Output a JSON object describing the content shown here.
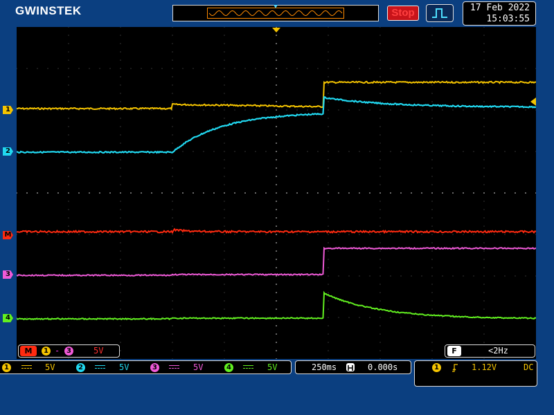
{
  "brand": "GWINSTEK",
  "run_state": "Stop",
  "datetime": {
    "date": "17 Feb 2022",
    "time": "15:03:55"
  },
  "colors": {
    "ch1": "#f5c400",
    "ch2": "#21d8f0",
    "ch3": "#f05ad8",
    "ch4": "#62f020",
    "math": "#ff2a10",
    "stop": "#ff4040",
    "grid": "#6a6a6a"
  },
  "channel_markers": [
    {
      "id": "1",
      "label": "1"
    },
    {
      "id": "2",
      "label": "2"
    },
    {
      "id": "M",
      "label": "M"
    },
    {
      "id": "3",
      "label": "3"
    },
    {
      "id": "4",
      "label": "4"
    }
  ],
  "math": {
    "badge": "M",
    "src_a": "1",
    "op": "-",
    "src_b": "3",
    "scale": "5V"
  },
  "frequency": {
    "badge": "F",
    "value": "<2Hz"
  },
  "channels": [
    {
      "num": "1",
      "coupling_icon": "dc-coupling-icon",
      "scale": "5V"
    },
    {
      "num": "2",
      "coupling_icon": "dc-coupling-icon",
      "scale": "5V"
    },
    {
      "num": "3",
      "coupling_icon": "dc-coupling-icon",
      "scale": "5V"
    },
    {
      "num": "4",
      "coupling_icon": "dc-coupling-icon",
      "scale": "5V"
    }
  ],
  "timebase": {
    "scale": "250ms",
    "position_icon": "h-position-icon",
    "position": "0.000s"
  },
  "trigger": {
    "source": "1",
    "edge_icon": "rising-edge-icon",
    "level": "1.12V",
    "coupling": "DC"
  }
}
